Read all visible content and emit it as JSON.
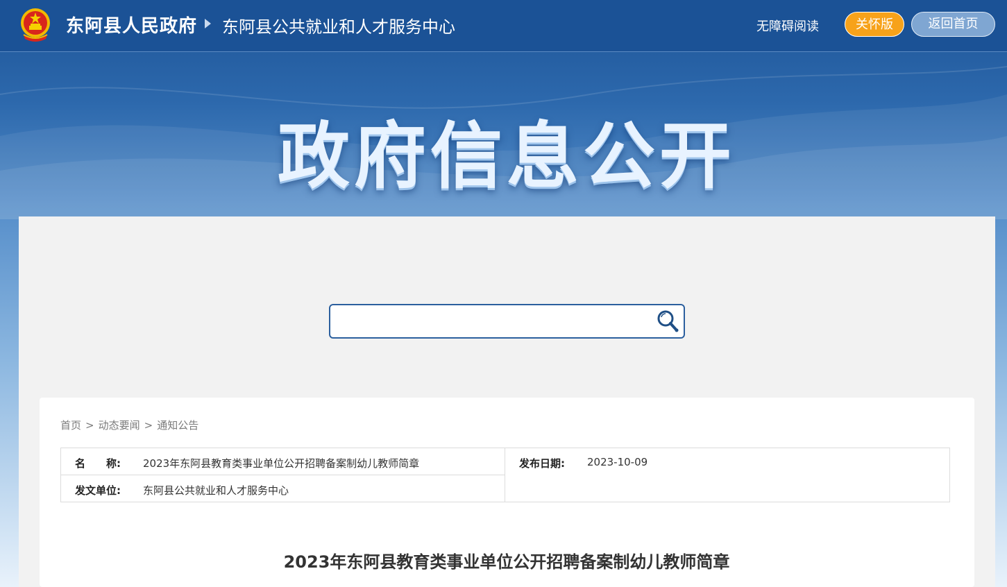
{
  "header": {
    "site_name": "东阿县人民政府",
    "sub_name": "东阿县公共就业和人才服务中心",
    "accessible_label": "无障碍阅读",
    "care_label": "关怀版",
    "home_label": "返回首页"
  },
  "banner": {
    "title": "政府信息公开"
  },
  "search": {
    "placeholder": ""
  },
  "breadcrumb": {
    "items": [
      "首页",
      "动态要闻",
      "通知公告"
    ],
    "separator": ">"
  },
  "info": {
    "name_label": "名　　称:",
    "name_value": "2023年东阿县教育类事业单位公开招聘备案制幼儿教师简章",
    "date_label": "发布日期:",
    "date_value": "2023-10-09",
    "issuer_label": "发文单位:",
    "issuer_value": "东阿县公共就业和人才服务中心"
  },
  "article": {
    "title": "2023年东阿县教育类事业单位公开招聘备案制幼儿教师简章"
  },
  "colors": {
    "header_bg": "#1b5296",
    "care_button": "#f7a21a",
    "home_button": "#7fa6d2",
    "search_border": "#2b5f9e"
  }
}
